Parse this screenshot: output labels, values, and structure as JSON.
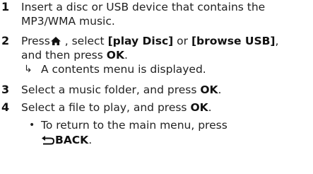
{
  "steps": [
    {
      "number": "1",
      "line1": "Insert a disc or USB device that contains the",
      "line2": "MP3/WMA music."
    },
    {
      "number": "2",
      "press_label": "Press",
      "after_icon": " , select ",
      "option1": "[play Disc]",
      "or_label": " or ",
      "option2": "[browse USB]",
      "comma": ",",
      "line2_prefix": "and then press ",
      "line2_ok": "OK",
      "line2_suffix": ".",
      "result_arrow": "↳",
      "result_text": "A contents menu is displayed."
    },
    {
      "number": "3",
      "text": "Select a music folder, and press ",
      "ok": "OK",
      "suffix": "."
    },
    {
      "number": "4",
      "text": "Select a file to play, and press ",
      "ok": "OK",
      "suffix": ".",
      "bullet": "•",
      "bullet_text": "To return to the main menu, press",
      "back_label": "BACK",
      "back_suffix": "."
    }
  ],
  "icons": {
    "home": "home-icon",
    "back": "back-icon"
  }
}
